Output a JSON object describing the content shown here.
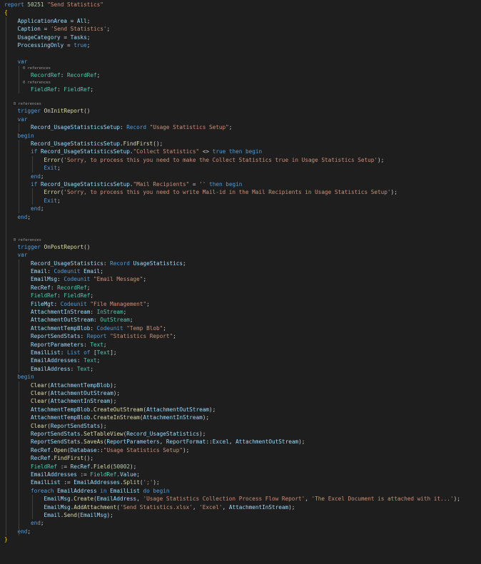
{
  "editor": {
    "language": "AL",
    "background": "#1e1e1e",
    "lines": [
      {
        "text": "report 50251 \"Send Statistics\""
      },
      {
        "text": "{"
      },
      {
        "text": "    ApplicationArea = All;"
      },
      {
        "text": "    Caption = 'Send Statistics';"
      },
      {
        "text": "    UsageCategory = Tasks;"
      },
      {
        "text": "    ProcessingOnly = true;"
      },
      {
        "text": ""
      },
      {
        "text": "    var"
      },
      {
        "text": "        0 references",
        "lens": true
      },
      {
        "text": "        RecordRef: RecordRef;"
      },
      {
        "text": "        0 references",
        "lens": true
      },
      {
        "text": "        FieldRef: FieldRef;"
      },
      {
        "text": ""
      },
      {
        "text": "    0 references",
        "lens": true
      },
      {
        "text": "    trigger OnInitReport()"
      },
      {
        "text": "    var"
      },
      {
        "text": "        Record_UsageStatisticsSetup: Record \"Usage Statistics Setup\";"
      },
      {
        "text": "    begin"
      },
      {
        "text": "        Record_UsageStatisticsSetup.FindFirst();"
      },
      {
        "text": "        if Record_UsageStatisticsSetup.\"Collect Statistics\" <> true then begin"
      },
      {
        "text": "            Error('Sorry, to process this you need to make the Collect Statistics true in Usage Statistics Setup');"
      },
      {
        "text": "            Exit;"
      },
      {
        "text": "        end;"
      },
      {
        "text": "        if Record_UsageStatisticsSetup.\"Mail Recipients\" = '' then begin"
      },
      {
        "text": "            Error('Sorry, to process this you need to write Mail-id in the Mail Recipients in Usage Statistics Setup');"
      },
      {
        "text": "            Exit;"
      },
      {
        "text": "        end;"
      },
      {
        "text": "    end;"
      },
      {
        "text": ""
      },
      {
        "text": ""
      },
      {
        "text": "    0 references",
        "lens": true
      },
      {
        "text": "    trigger OnPostReport()"
      },
      {
        "text": "    var"
      },
      {
        "text": "        Record_UsageStatistics: Record UsageStatistics;"
      },
      {
        "text": "        Email: Codeunit Email;"
      },
      {
        "text": "        EmailMsg: Codeunit \"Email Message\";"
      },
      {
        "text": "        RecRef: RecordRef;"
      },
      {
        "text": "        FieldRef: FieldRef;"
      },
      {
        "text": "        FileMgt: Codeunit \"File Management\";"
      },
      {
        "text": "        AttachmentInStream: InStream;"
      },
      {
        "text": "        AttachmentOutStream: OutStream;"
      },
      {
        "text": "        AttachmentTempBlob: Codeunit \"Temp Blob\";"
      },
      {
        "text": "        ReportSendStats: Report \"Statistics Report\";"
      },
      {
        "text": "        ReportParameters: Text;"
      },
      {
        "text": "        EmailList: List of [Text];"
      },
      {
        "text": "        EmailAddresses: Text;"
      },
      {
        "text": "        EmailAddress: Text;"
      },
      {
        "text": "    begin"
      },
      {
        "text": "        Clear(AttachmentTempBlob);"
      },
      {
        "text": "        Clear(AttachmentOutStream);"
      },
      {
        "text": "        Clear(AttachmentInStream);"
      },
      {
        "text": "        AttachmentTempBlob.CreateOutStream(AttachmentOutStream);"
      },
      {
        "text": "        AttachmentTempBlob.CreateInStream(AttachmentInStream);"
      },
      {
        "text": "        Clear(ReportSendStats);"
      },
      {
        "text": "        ReportSendStats.SetTableView(Record_UsageStatistics);"
      },
      {
        "text": "        ReportSendStats.SaveAs(ReportParameters, ReportFormat::Excel, AttachmentOutStream);"
      },
      {
        "text": "        RecRef.Open(Database::\"Usage Statistics Setup\");"
      },
      {
        "text": "        RecRef.FindFirst();"
      },
      {
        "text": "        FieldRef := RecRef.Field(50002);"
      },
      {
        "text": "        EmailAddresses := FieldRef.Value;"
      },
      {
        "text": "        EmailList := EmailAddresses.Split(';');"
      },
      {
        "text": "        foreach EmailAddress in EmailList do begin"
      },
      {
        "text": "            EmailMsg.Create(EmailAddress, 'Usage Statistics Collection Process Flow Report', 'The Excel Document is attached with it...');"
      },
      {
        "text": "            EmailMsg.AddAttachment('Send Statistics.xlsx', 'Excel', AttachmentInStream);"
      },
      {
        "text": "            Email.Send(EmailMsg);"
      },
      {
        "text": "        end;"
      },
      {
        "text": "    end;"
      },
      {
        "text": "}"
      }
    ]
  }
}
